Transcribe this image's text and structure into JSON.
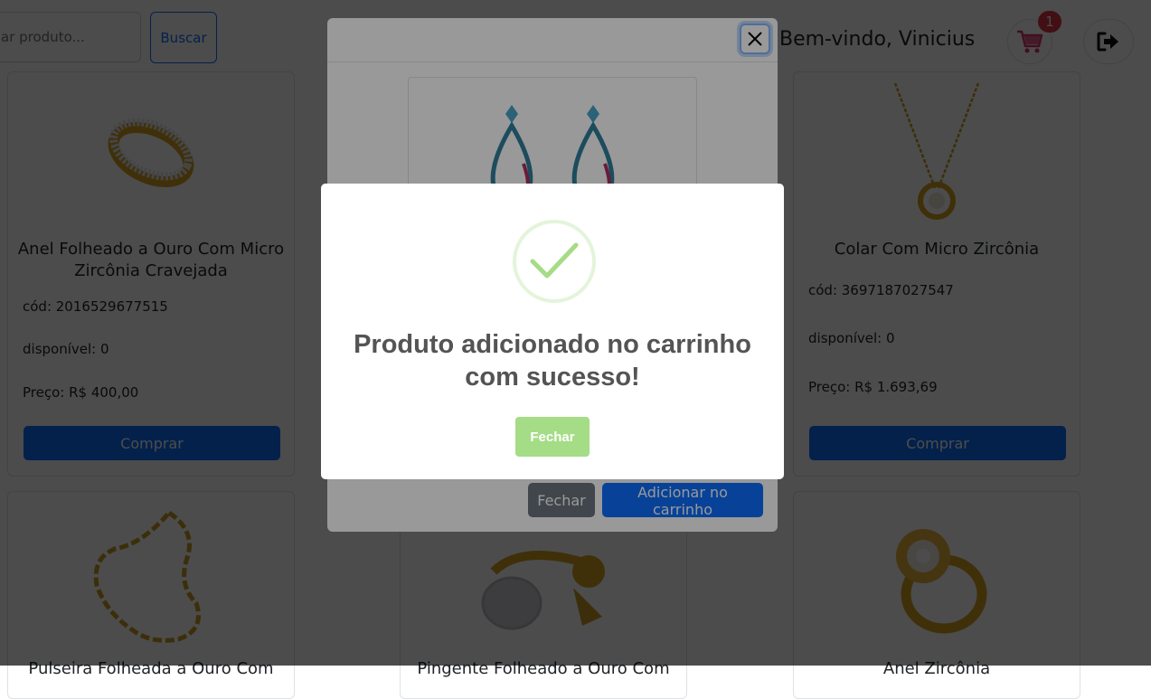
{
  "header": {
    "search_placeholder": "ar produto...",
    "search_button": "Buscar",
    "welcome": "Bem-vindo, Vinicius",
    "cart_count": "1"
  },
  "products": [
    {
      "title": "Anel Folheado a Ouro Com Micro Zircônia Cravejada",
      "code": "cód: 2016529677515",
      "available": "disponível: 0",
      "price": "Preço: R$ 400,00",
      "buy": "Comprar"
    },
    {
      "title": "Colar Com Micro Zircônia",
      "code": "cód: 3697187027547",
      "available": "disponível: 0",
      "price": "Preço: R$ 1.693,69",
      "buy": "Comprar"
    },
    {
      "title": "Pulseira Folheada a Ouro Com"
    },
    {
      "title": "Pingente Folheado a Ouro Com"
    },
    {
      "title": "Anel Zircônia"
    }
  ],
  "modal": {
    "close_button": "Fechar",
    "add_to_cart_button": "Adicionar no carrinho"
  },
  "alert": {
    "title": "Produto adicionado no carrinho com sucesso!",
    "close_button": "Fechar",
    "accent_color": "#a5dc86"
  },
  "colors": {
    "primary": "#0d6efd",
    "secondary": "#6c757d",
    "danger": "#dc3545"
  }
}
